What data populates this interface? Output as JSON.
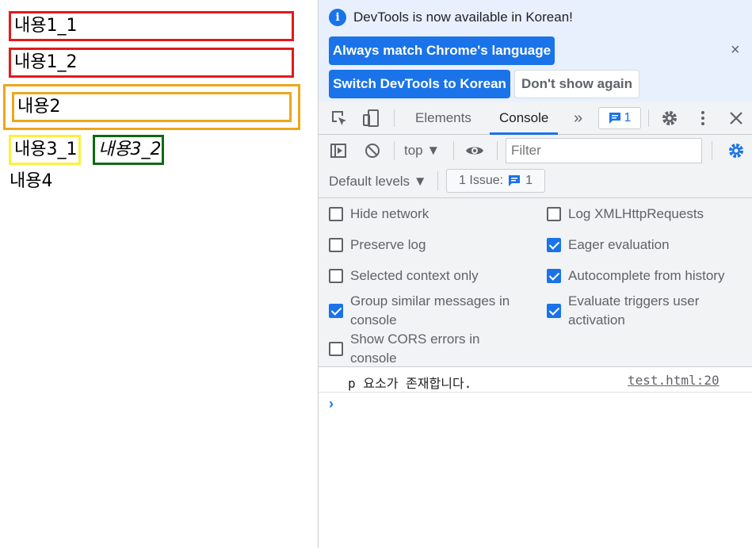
{
  "page": {
    "c1": "내용1_1",
    "c2": "내용1_2",
    "c3": "내용2",
    "c31": "내용3_1",
    "c32": "내용3_2",
    "c4": "내용4"
  },
  "infobar": {
    "message": "DevTools is now available in Korean!",
    "info_icon": "i",
    "match_label": "Always match Chrome's language",
    "switch_label": "Switch DevTools to Korean",
    "dont_show_label": "Don't show again",
    "close": "×"
  },
  "tabs": {
    "elements": "Elements",
    "console": "Console",
    "more": "»",
    "issues_count": "1"
  },
  "toolbar": {
    "context": "top ▼",
    "filter_placeholder": "Filter",
    "levels": "Default levels ▼",
    "issue_label": "1 Issue:",
    "issue_count": "1"
  },
  "settings": {
    "hide_network": "Hide network",
    "log_xhr": "Log XMLHttpRequests",
    "preserve_log": "Preserve log",
    "eager_eval": "Eager evaluation",
    "selected_context": "Selected context only",
    "autocomplete": "Autocomplete from history",
    "group_similar": "Group similar messages in console",
    "evaluate_triggers": "Evaluate triggers user activation",
    "show_cors": "Show CORS errors in console"
  },
  "console": {
    "message": "p 요소가 존재합니다.",
    "source": "test.html:20",
    "prompt": "›"
  },
  "colors": {
    "red_border": "#e01b1b",
    "orange_border": "#eea61a",
    "yellow_border": "#f8f23a",
    "green_border": "#0e6a12",
    "accent": "#1a73e8"
  }
}
